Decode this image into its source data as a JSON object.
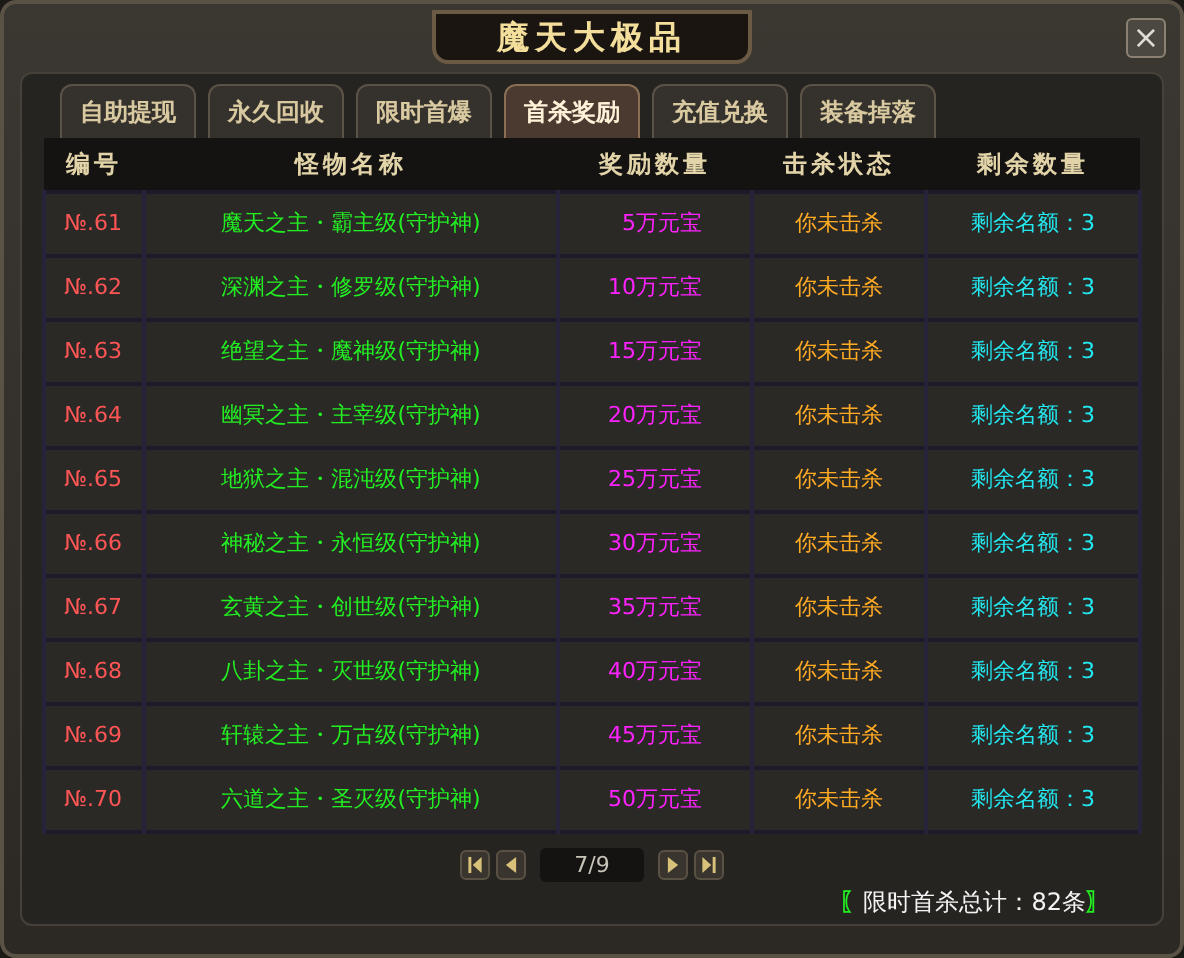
{
  "window": {
    "title": "魔天大极品",
    "close": "×"
  },
  "tabs": [
    {
      "label": "自助提现",
      "selected": false
    },
    {
      "label": "永久回收",
      "selected": false
    },
    {
      "label": "限时首爆",
      "selected": false
    },
    {
      "label": "首杀奖励",
      "selected": true
    },
    {
      "label": "充值兑换",
      "selected": false
    },
    {
      "label": "装备掉落",
      "selected": false
    }
  ],
  "table": {
    "columns": [
      "编号",
      "怪物名称",
      "奖励数量",
      "击杀状态",
      "剩余数量"
    ],
    "rows": [
      [
        "№.61",
        "魔天之主・霸主级(守护神)",
        "5万元宝",
        "你未击杀",
        "剩余名额：3"
      ],
      [
        "№.62",
        "深渊之主・修罗级(守护神)",
        "10万元宝",
        "你未击杀",
        "剩余名额：3"
      ],
      [
        "№.63",
        "绝望之主・魔神级(守护神)",
        "15万元宝",
        "你未击杀",
        "剩余名额：3"
      ],
      [
        "№.64",
        "幽冥之主・主宰级(守护神)",
        "20万元宝",
        "你未击杀",
        "剩余名额：3"
      ],
      [
        "№.65",
        "地狱之主・混沌级(守护神)",
        "25万元宝",
        "你未击杀",
        "剩余名额：3"
      ],
      [
        "№.66",
        "神秘之主・永恒级(守护神)",
        "30万元宝",
        "你未击杀",
        "剩余名额：3"
      ],
      [
        "№.67",
        "玄黄之主・创世级(守护神)",
        "35万元宝",
        "你未击杀",
        "剩余名额：3"
      ],
      [
        "№.68",
        "八卦之主・灭世级(守护神)",
        "40万元宝",
        "你未击杀",
        "剩余名额：3"
      ],
      [
        "№.69",
        "轩辕之主・万古级(守护神)",
        "45万元宝",
        "你未击杀",
        "剩余名额：3"
      ],
      [
        "№.70",
        "六道之主・圣灭级(守护神)",
        "50万元宝",
        "你未击杀",
        "剩余名额：3"
      ]
    ]
  },
  "pager": {
    "page": "7/9"
  },
  "footer": {
    "open": "〖",
    "text": "限时首杀总计：82条",
    "close": "〗"
  }
}
